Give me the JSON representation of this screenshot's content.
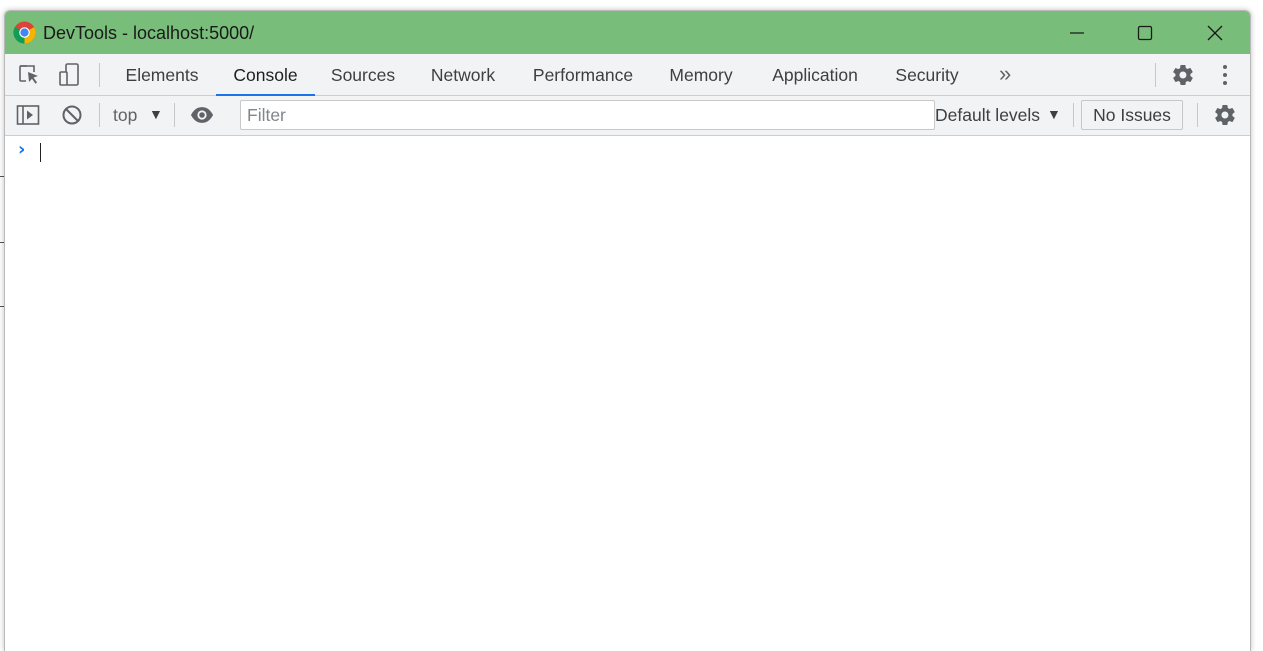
{
  "window": {
    "title": "DevTools - localhost:5000/",
    "titlebar_color": "#79bd7b"
  },
  "toolbar": {
    "inspect_icon": "inspect-element-icon",
    "device_icon": "device-toolbar-icon",
    "tabs": [
      {
        "label": "Elements",
        "active": false
      },
      {
        "label": "Console",
        "active": true
      },
      {
        "label": "Sources",
        "active": false
      },
      {
        "label": "Network",
        "active": false
      },
      {
        "label": "Performance",
        "active": false
      },
      {
        "label": "Memory",
        "active": false
      },
      {
        "label": "Application",
        "active": false
      },
      {
        "label": "Security",
        "active": false
      }
    ],
    "more_tabs": "»",
    "accent_color": "#1a73e8"
  },
  "console_toolbar": {
    "context": "top",
    "filter_placeholder": "Filter",
    "filter_value": "",
    "levels": "Default levels",
    "issues": "No Issues"
  },
  "console": {
    "prompt": "›"
  }
}
